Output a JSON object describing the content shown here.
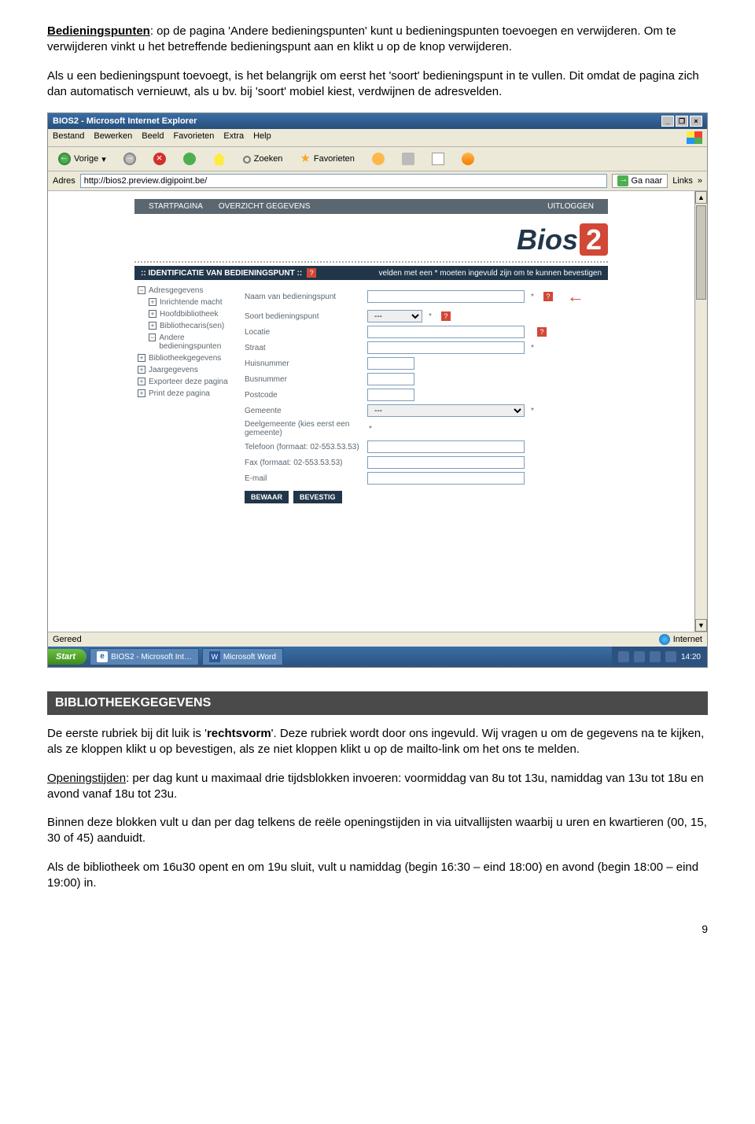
{
  "para1": {
    "lead": "Bedieningspunten",
    "rest": ": op de pagina 'Andere bedieningspunten' kunt u bedieningspunten toevoegen en verwijderen. Om te verwijderen vinkt u het betreffende bedieningspunt aan en klikt u op de knop verwijderen."
  },
  "para2": "Als u een bedieningspunt toevoegt, is het belangrijk om eerst het 'soort' bedieningspunt in te vullen. Dit omdat de pagina zich dan automatisch vernieuwt, als u bv. bij 'soort' mobiel kiest, verdwijnen de adresvelden.",
  "screenshot": {
    "window_title": "BIOS2 - Microsoft Internet Explorer",
    "menubar": [
      "Bestand",
      "Bewerken",
      "Beeld",
      "Favorieten",
      "Extra",
      "Help"
    ],
    "toolbar": {
      "back": "Vorige",
      "search": "Zoeken",
      "fav": "Favorieten"
    },
    "addr_label": "Adres",
    "url": "http://bios2.preview.digipoint.be/",
    "go": "Ga naar",
    "links": "Links",
    "topnav": {
      "a": "STARTPAGINA",
      "b": "OVERZICHT GEGEVENS",
      "c": "UITLOGGEN"
    },
    "logo": {
      "text": "Bios",
      "num": "2"
    },
    "section": {
      "title": ":: IDENTIFICATIE VAN BEDIENINGSPUNT ::",
      "note": "velden met een * moeten ingevuld zijn om te kunnen bevestigen"
    },
    "tree": [
      {
        "sym": "−",
        "label": "Adresgegevens",
        "sub": false
      },
      {
        "sym": "+",
        "label": "Inrichtende macht",
        "sub": true
      },
      {
        "sym": "+",
        "label": "Hoofdbibliotheek",
        "sub": true
      },
      {
        "sym": "+",
        "label": "Bibliothecaris(sen)",
        "sub": true
      },
      {
        "sym": "−",
        "label": "Andere bedieningspunten",
        "sub": true
      },
      {
        "sym": "+",
        "label": "Bibliotheekgegevens",
        "sub": false
      },
      {
        "sym": "+",
        "label": "Jaargegevens",
        "sub": false
      },
      {
        "sym": "+",
        "label": "Exporteer deze pagina",
        "sub": false
      },
      {
        "sym": "+",
        "label": "Print deze pagina",
        "sub": false
      }
    ],
    "fields": {
      "naam": "Naam van bedieningspunt",
      "soort": "Soort bedieningspunt",
      "soort_val": "---",
      "locatie": "Locatie",
      "straat": "Straat",
      "huisnr": "Huisnummer",
      "busnr": "Busnummer",
      "postcode": "Postcode",
      "gemeente": "Gemeente",
      "gemeente_val": "---",
      "deelgem": "Deelgemeente (kies eerst een gemeente)",
      "tel": "Telefoon (formaat: 02-553.53.53)",
      "fax": "Fax (formaat: 02-553.53.53)",
      "email": "E-mail"
    },
    "buttons": {
      "bewaar": "BEWAAR",
      "bevestig": "BEVESTIG"
    },
    "status": {
      "ready": "Gereed",
      "zone": "Internet"
    },
    "taskbar": {
      "start": "Start",
      "t1": "BIOS2 - Microsoft Int…",
      "t2": "Microsoft Word",
      "time": "14:20"
    }
  },
  "section_header": "BIBLIOTHEEKGEGEVENS",
  "para3": {
    "a": "De eerste rubriek bij dit luik is '",
    "b": "rechtsvorm",
    "c": "'. Deze rubriek wordt door ons ingevuld. Wij vragen u om de gegevens na te kijken, als ze kloppen klikt u op bevestigen, als ze niet kloppen klikt u op de mailto-link om het ons te melden."
  },
  "para4": {
    "lead": "Openingstijden",
    "rest": ": per dag kunt u maximaal drie tijdsblokken invoeren: voormiddag van 8u tot 13u, namiddag van 13u tot 18u en avond vanaf 18u tot 23u."
  },
  "para5": "Binnen deze blokken vult u dan per dag telkens de reële openingstijden in via uitvallijsten waarbij u uren en kwartieren (00, 15, 30 of 45) aanduidt.",
  "para6": "Als de bibliotheek om 16u30 opent en om 19u sluit, vult u namiddag (begin 16:30 – eind 18:00) en avond (begin 18:00 – eind 19:00) in.",
  "page_num": "9"
}
